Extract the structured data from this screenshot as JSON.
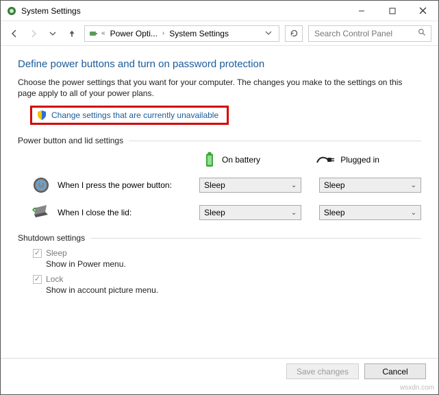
{
  "window": {
    "title": "System Settings"
  },
  "breadcrumb": {
    "level1": "Power Opti...",
    "level2": "System Settings"
  },
  "search": {
    "placeholder": "Search Control Panel"
  },
  "main": {
    "heading": "Define power buttons and turn on password protection",
    "description": "Choose the power settings that you want for your computer. The changes you make to the settings on this page apply to all of your power plans.",
    "change_link": "Change settings that are currently unavailable",
    "section_power": "Power button and lid settings",
    "col_battery": "On battery",
    "col_plugged": "Plugged in",
    "row_power_button": "When I press the power button:",
    "row_lid": "When I close the lid:",
    "dd_power_battery": "Sleep",
    "dd_power_plugged": "Sleep",
    "dd_lid_battery": "Sleep",
    "dd_lid_plugged": "Sleep",
    "section_shutdown": "Shutdown settings",
    "sleep_label": "Sleep",
    "sleep_sub": "Show in Power menu.",
    "lock_label": "Lock",
    "lock_sub": "Show in account picture menu."
  },
  "buttons": {
    "save": "Save changes",
    "cancel": "Cancel"
  },
  "watermark": "wsxdn.com"
}
